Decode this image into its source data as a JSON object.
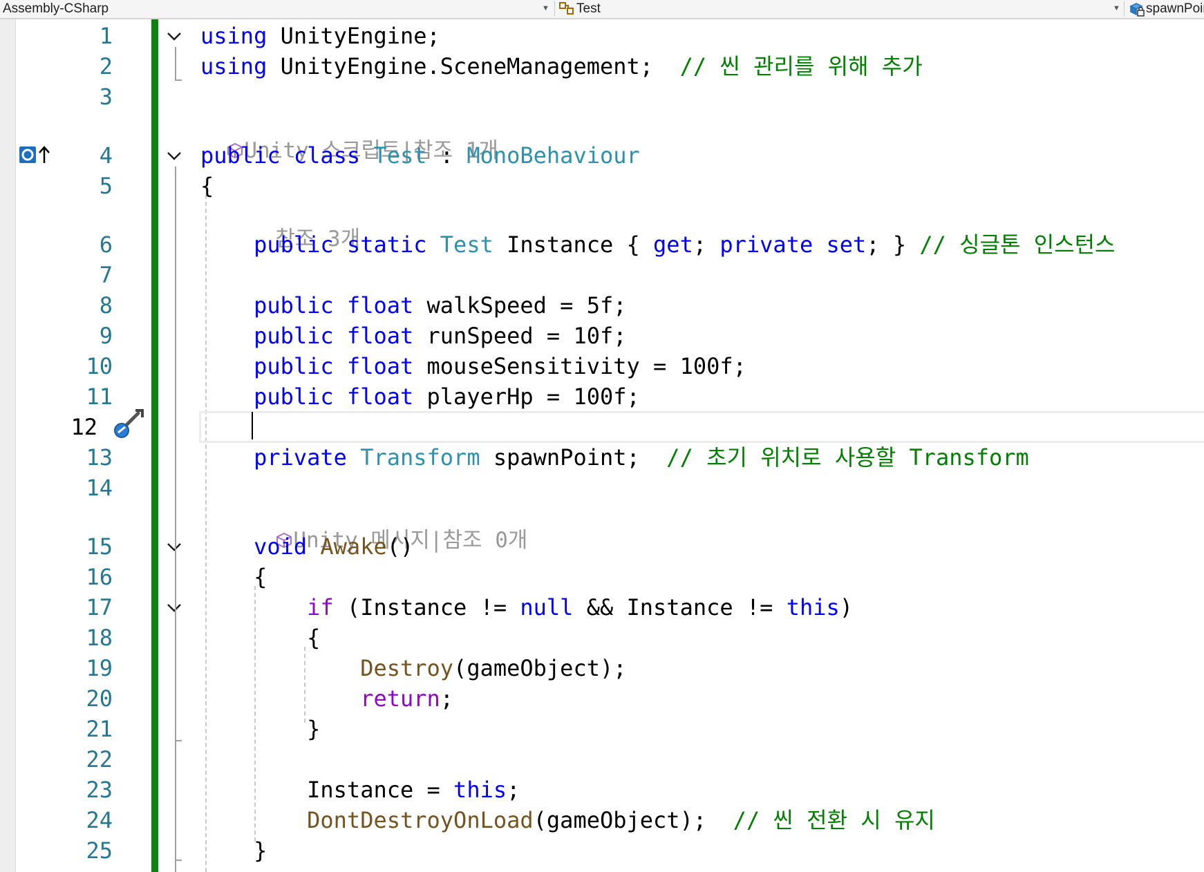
{
  "navbar": {
    "project": "Assembly-CSharp",
    "class": "Test",
    "member": "spawnPoint"
  },
  "lines": [
    {
      "n": "1",
      "html": "<span class=\"kw\">using</span> UnityEngine;"
    },
    {
      "n": "2",
      "html": "<span class=\"kw\">using</span> UnityEngine.SceneManagement;  <span class=\"cm\">// 씬 관리를 위해 추가</span>"
    },
    {
      "n": "3",
      "html": ""
    },
    {
      "n": "4",
      "html": "<span class=\"kw\">public</span> <span class=\"kw\">class</span> <span class=\"ty\">Test</span> : <span class=\"ty\">MonoBehaviour</span>"
    },
    {
      "n": "5",
      "html": "{"
    },
    {
      "n": "6",
      "html": "    <span class=\"kw\">public</span> <span class=\"kw\">static</span> <span class=\"ty\">Test</span> Instance { <span class=\"kw\">get</span>; <span class=\"kw\">private</span> <span class=\"kw\">set</span>; } <span class=\"cm\">// 싱글톤 인스턴스</span>"
    },
    {
      "n": "7",
      "html": ""
    },
    {
      "n": "8",
      "html": "    <span class=\"kw\">public</span> <span class=\"kw\">float</span> walkSpeed = 5f;"
    },
    {
      "n": "9",
      "html": "    <span class=\"kw\">public</span> <span class=\"kw\">float</span> runSpeed = 10f;"
    },
    {
      "n": "10",
      "html": "    <span class=\"kw\">public</span> <span class=\"kw\">float</span> mouseSensitivity = 100f;"
    },
    {
      "n": "11",
      "html": "    <span class=\"kw\">public</span> <span class=\"kw\">float</span> playerHp = 100f;"
    },
    {
      "n": "12",
      "html": ""
    },
    {
      "n": "13",
      "html": "    <span class=\"kw\">private</span> <span class=\"ty\">Transform</span> spawnPoint;  <span class=\"cm\">// 초기 위치로 사용할 Transform</span>"
    },
    {
      "n": "14",
      "html": ""
    },
    {
      "n": "15",
      "html": "    <span class=\"kw\">void</span> <span class=\"mth\">Awake</span>()"
    },
    {
      "n": "16",
      "html": "    {"
    },
    {
      "n": "17",
      "html": "        <span class=\"ctl\">if</span> (Instance != <span class=\"kw\">null</span> &amp;&amp; Instance != <span class=\"kw\">this</span>)"
    },
    {
      "n": "18",
      "html": "        {"
    },
    {
      "n": "19",
      "html": "            <span class=\"mth\">Destroy</span>(gameObject);"
    },
    {
      "n": "20",
      "html": "            <span class=\"ctl\">return</span>;"
    },
    {
      "n": "21",
      "html": "        }"
    },
    {
      "n": "22",
      "html": ""
    },
    {
      "n": "23",
      "html": "        Instance = <span class=\"kw\">this</span>;"
    },
    {
      "n": "24",
      "html": "        <span class=\"mth\">DontDestroyOnLoad</span>(gameObject);  <span class=\"cm\">// 씬 전환 시 유지</span>"
    },
    {
      "n": "25",
      "html": "    }"
    }
  ],
  "lenses": [
    {
      "text": "Unity 스크립트|참조 1개",
      "cube": true
    },
    {
      "text": "참조 3개",
      "cube": false
    },
    {
      "text": "Unity 메시지|참조 0개",
      "cube": true
    }
  ],
  "current_line": "12",
  "colors": {
    "keyword": "#0000ff",
    "type": "#2b91af",
    "comment": "#008000",
    "control": "#8f08c4",
    "method": "#74531f",
    "line_number": "#237893",
    "change_bar": "#108010"
  }
}
